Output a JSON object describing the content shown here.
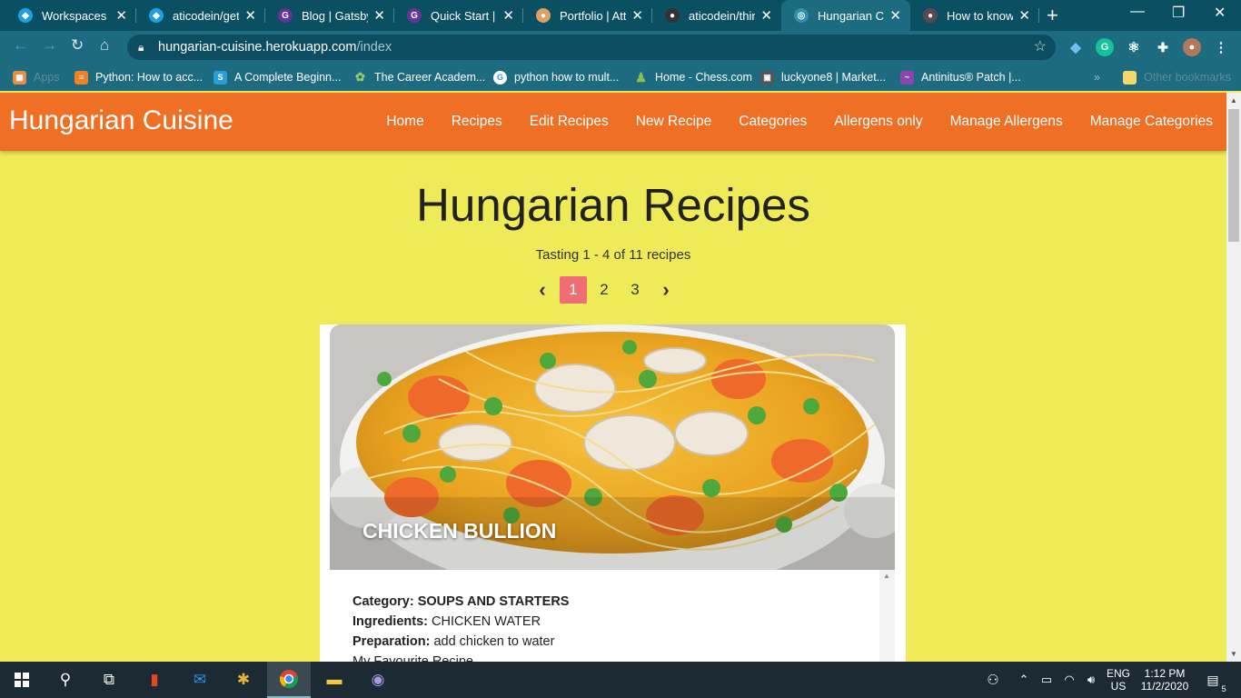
{
  "browser": {
    "tabs": [
      {
        "title": "Workspaces - C",
        "icon": "cube-icon",
        "color": "#1ba1e2"
      },
      {
        "title": "aticodein/gets",
        "icon": "cube-icon",
        "color": "#1ba1e2"
      },
      {
        "title": "Blog | Gatsby.J",
        "icon": "gatsby-icon",
        "color": "#663399"
      },
      {
        "title": "Quick Start | G",
        "icon": "gatsby-icon",
        "color": "#663399"
      },
      {
        "title": "Portfolio | Attil",
        "icon": "person-icon",
        "color": "#e0a060"
      },
      {
        "title": "aticodein/third",
        "icon": "github-icon",
        "color": "#333333"
      },
      {
        "title": "Hungarian Cui",
        "icon": "globe-icon",
        "color": "#2e8fb0"
      },
      {
        "title": "How to know t",
        "icon": "avatar-icon",
        "color": "#5a4a4a"
      }
    ],
    "url": "hungarian-cuisine.herokuapp.com",
    "url_path": "/index",
    "bookmarks": [
      {
        "label": "Apps",
        "icon": "apps-grid-icon",
        "dim": true
      },
      {
        "label": "Python: How to acc...",
        "icon": "stackoverflow-icon"
      },
      {
        "label": "A Complete Beginn...",
        "icon": "s-icon"
      },
      {
        "label": "The Career Academ...",
        "icon": "leaf-icon"
      },
      {
        "label": "python how to mult...",
        "icon": "google-icon"
      },
      {
        "label": "Home - Chess.com",
        "icon": "pawn-icon"
      },
      {
        "label": "luckyone8 | Market...",
        "icon": "market-icon"
      },
      {
        "label": "Antinitus® Patch |...",
        "icon": "wave-icon"
      },
      {
        "label": "Other bookmarks",
        "icon": "folder-icon",
        "dim": true
      }
    ]
  },
  "site": {
    "brand": "Hungarian Cuisine",
    "menu": [
      "Home",
      "Recipes",
      "Edit Recipes",
      "New Recipe",
      "Categories",
      "Allergens only",
      "Manage Allergens",
      "Manage Categories"
    ],
    "title": "Hungarian Recipes",
    "subtitle": "Tasting 1 - 4 of 11 recipes",
    "pages": [
      "1",
      "2",
      "3"
    ],
    "current_page": "1",
    "colors": {
      "navbar": "#ef6f24",
      "background": "#efea57",
      "active_page": "#ee6e73"
    }
  },
  "recipe": {
    "name": "CHICKEN BULLION",
    "category_label": "Category:",
    "category": "SOUPS AND STARTERS",
    "ingredients_label": "Ingredients:",
    "ingredients": "CHICKEN WATER",
    "preparation_label": "Preparation:",
    "preparation": "add chicken to water",
    "extra": "My Favourite Recipe"
  },
  "taskbar": {
    "language": "ENG",
    "region": "US",
    "time": "1:12 PM",
    "date": "11/2/2020",
    "notifications": "5"
  }
}
